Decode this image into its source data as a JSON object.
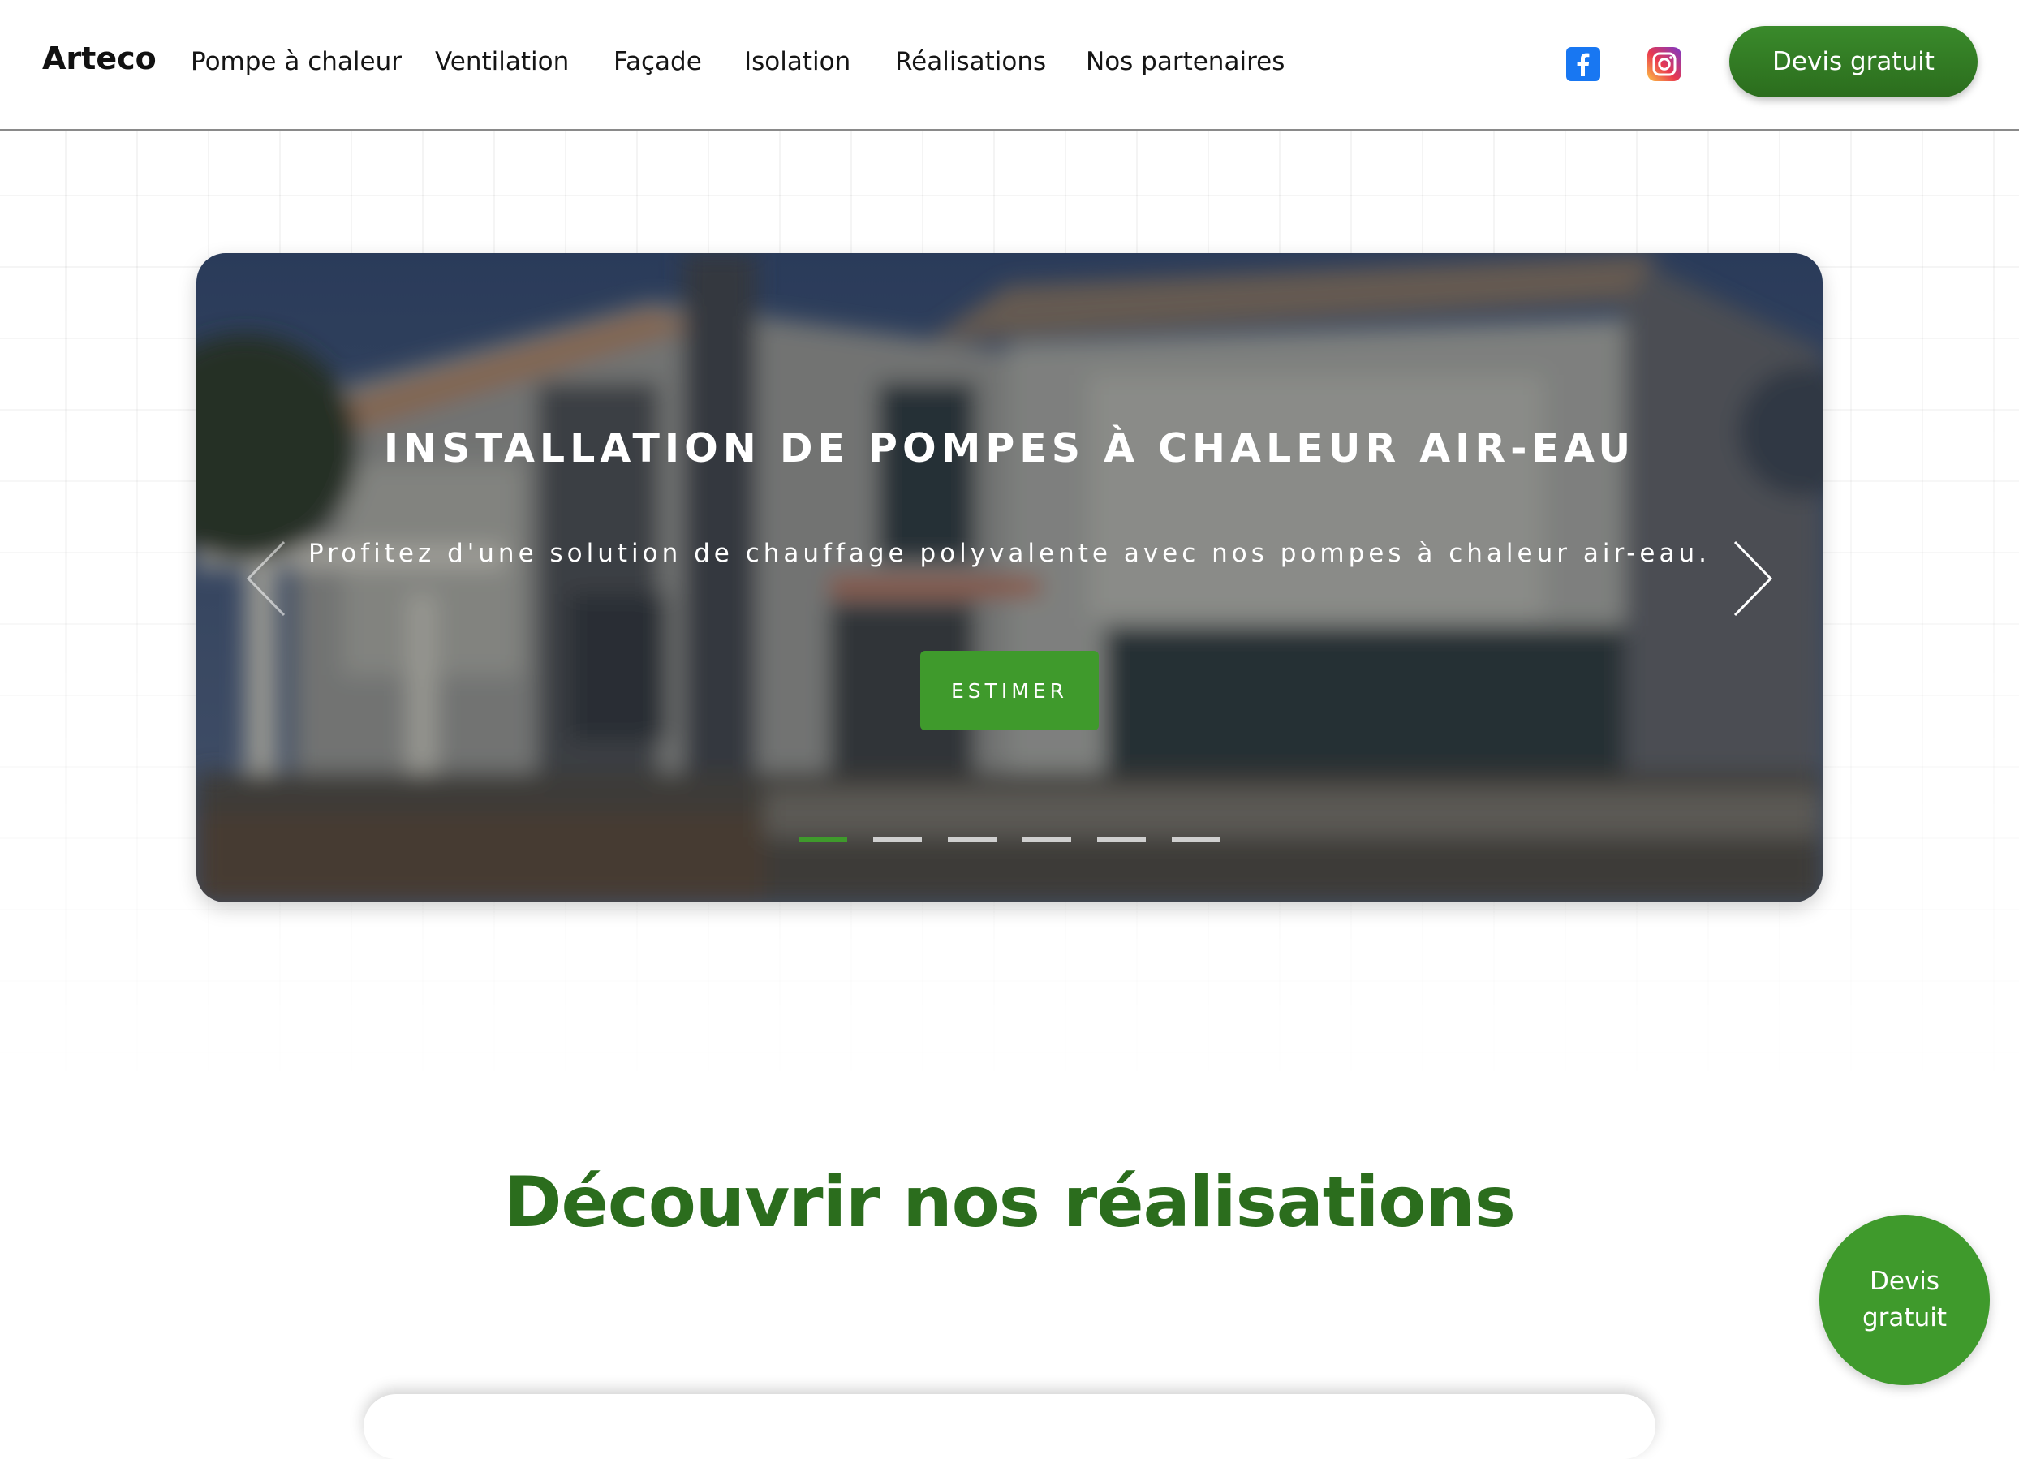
{
  "brand": {
    "name": "Arteco",
    "accent": "#3f9a2c",
    "dark_accent": "#2b6d1d"
  },
  "nav": {
    "items": [
      {
        "label": "Pompe à chaleur"
      },
      {
        "label": "Ventilation"
      },
      {
        "label": "Façade"
      },
      {
        "label": "Isolation"
      },
      {
        "label": "Réalisations"
      },
      {
        "label": "Nos partenaires"
      }
    ]
  },
  "social": {
    "facebook_icon": "facebook-icon",
    "instagram_icon": "instagram-icon"
  },
  "header": {
    "cta_label": "Devis gratuit"
  },
  "hero": {
    "title": "INSTALLATION DE POMPES À CHALEUR AIR-EAU",
    "subtitle": "Profitez d'une solution de chauffage polyvalente avec nos pompes à chaleur air-eau.",
    "button_label": "ESTIMER",
    "slides_count": 6,
    "active_slide": 1
  },
  "section": {
    "title": "Découvrir nos réalisations"
  },
  "floating": {
    "label": "Devis gratuit"
  }
}
